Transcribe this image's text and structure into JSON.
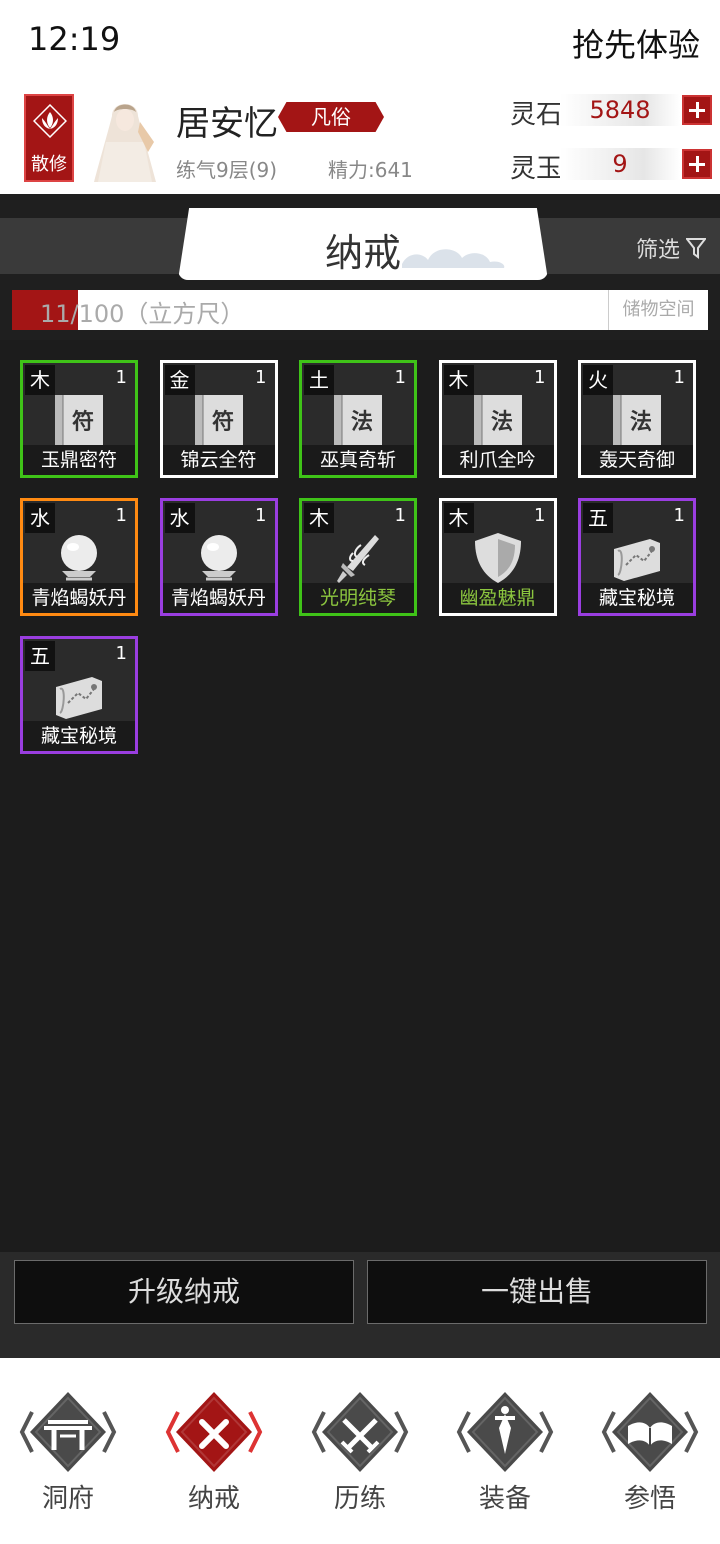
{
  "status_bar": {
    "time": "12:19",
    "promo": "抢先体验"
  },
  "player": {
    "sect": "散修",
    "name": "居安忆",
    "rank": "凡俗",
    "realm": "练气9层(9)",
    "energy": "精力:641"
  },
  "currency": [
    {
      "label": "灵石",
      "value": "5848"
    },
    {
      "label": "灵玉",
      "value": "9"
    }
  ],
  "title": "纳戒",
  "filter_label": "筛选",
  "capacity": {
    "text": "11/100（立方尺）",
    "used": 11,
    "max": 100
  },
  "storage_button": "储物空间",
  "items": [
    {
      "element": "木",
      "count": "1",
      "name": "玉鼎密符",
      "icon": "talisman-icon",
      "quality": "green"
    },
    {
      "element": "金",
      "count": "1",
      "name": "锦云全符",
      "icon": "talisman-icon",
      "quality": "white"
    },
    {
      "element": "土",
      "count": "1",
      "name": "巫真奇斩",
      "icon": "scroll-icon",
      "quality": "green"
    },
    {
      "element": "木",
      "count": "1",
      "name": "利爪全吟",
      "icon": "scroll-icon",
      "quality": "white"
    },
    {
      "element": "火",
      "count": "1",
      "name": "轰天奇御",
      "icon": "scroll-icon",
      "quality": "white"
    },
    {
      "element": "水",
      "count": "1",
      "name": "青焰蝎妖丹",
      "icon": "orb-icon",
      "quality": "orange"
    },
    {
      "element": "水",
      "count": "1",
      "name": "青焰蝎妖丹",
      "icon": "orb-icon",
      "quality": "purple"
    },
    {
      "element": "木",
      "count": "1",
      "name": "光明纯琴",
      "icon": "sword-icon",
      "quality": "green"
    },
    {
      "element": "木",
      "count": "1",
      "name": "幽盈魅鼎",
      "icon": "shield-icon",
      "quality": "white"
    },
    {
      "element": "五",
      "count": "1",
      "name": "藏宝秘境",
      "icon": "map-icon",
      "quality": "purple"
    },
    {
      "element": "五",
      "count": "1",
      "name": "藏宝秘境",
      "icon": "map-icon",
      "quality": "purple"
    }
  ],
  "actions": {
    "upgrade": "升级纳戒",
    "sell_all": "一键出售"
  },
  "nav": [
    {
      "label": "洞府",
      "icon": "gate-icon"
    },
    {
      "label": "纳戒",
      "icon": "close-icon",
      "active": true
    },
    {
      "label": "历练",
      "icon": "crossed-swords-icon"
    },
    {
      "label": "装备",
      "icon": "dagger-icon"
    },
    {
      "label": "参悟",
      "icon": "book-icon"
    }
  ],
  "colors": {
    "accent": "#a31515",
    "green": "#3fc318",
    "white": "#ffffff",
    "orange": "#ff8a12",
    "purple": "#9a3ee0"
  }
}
